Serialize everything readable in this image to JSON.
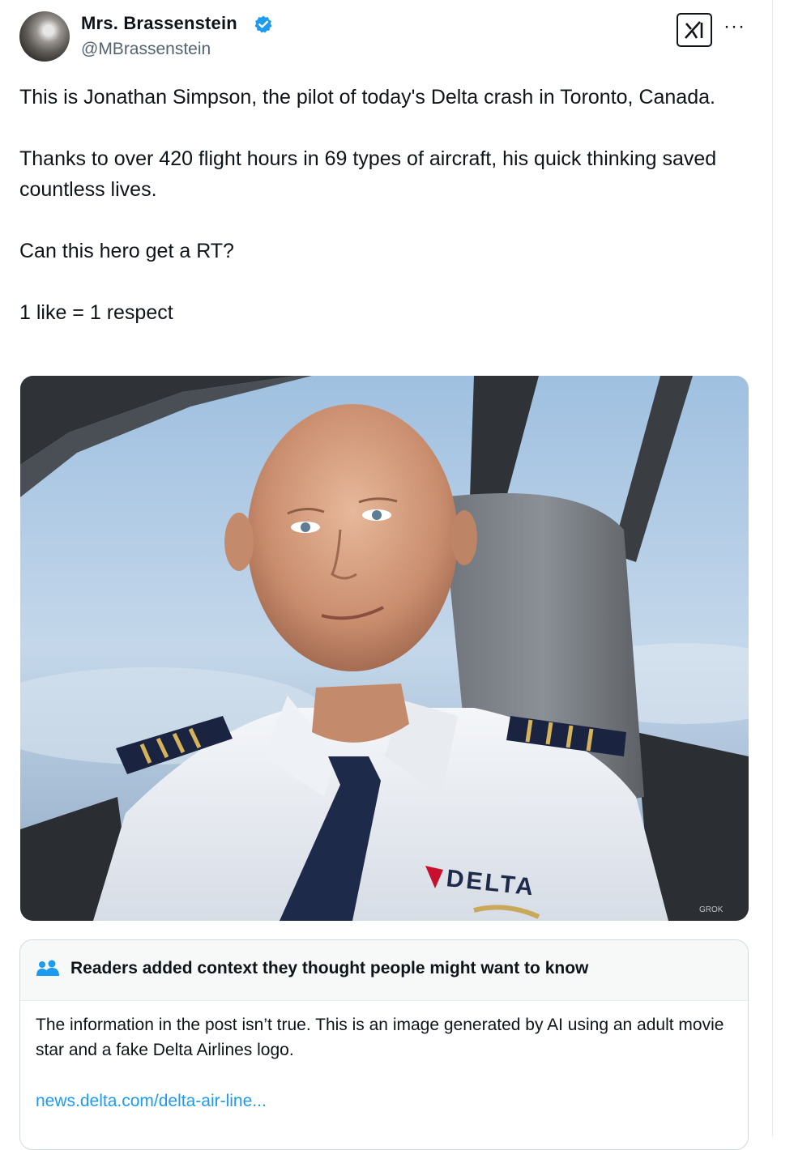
{
  "author": {
    "display_name": "Mrs. Brassenstein",
    "handle": "@MBrassenstein",
    "avatar_icon": "profile-avatar",
    "verified_icon": "verified-badge-icon"
  },
  "actions": {
    "grok_icon": "grok-icon",
    "more_label": "···"
  },
  "tweet": {
    "paragraphs": [
      "This is Jonathan Simpson, the pilot of today's Delta crash in Toronto, Canada.",
      "Thanks to over 420 flight hours in 69 types of aircraft, his quick thinking saved countless lives.",
      "Can this hero get a RT?",
      "1 like = 1 respect"
    ]
  },
  "media": {
    "shirt_logo": "DELTA",
    "watermark": "GROK"
  },
  "community_note": {
    "icon": "community-notes-icon",
    "title": "Readers added context they thought people might want to know",
    "body": "The information in the post isn’t true. This is an image generated by AI using an adult movie star and a fake Delta Airlines logo.",
    "link": "news.delta.com/delta-air-line..."
  },
  "colors": {
    "accent_blue": "#1d9bf0",
    "text_primary": "#0f1419",
    "text_secondary": "#536471",
    "border": "#cfd9de"
  }
}
